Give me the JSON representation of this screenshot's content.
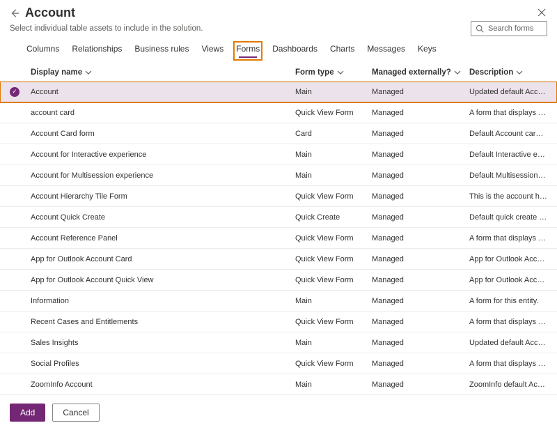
{
  "header": {
    "title": "Account",
    "subtitle": "Select individual table assets to include in the solution."
  },
  "search": {
    "placeholder": "Search forms"
  },
  "tabs": [
    {
      "label": "Columns",
      "active": false
    },
    {
      "label": "Relationships",
      "active": false
    },
    {
      "label": "Business rules",
      "active": false
    },
    {
      "label": "Views",
      "active": false
    },
    {
      "label": "Forms",
      "active": true,
      "highlighted": true
    },
    {
      "label": "Dashboards",
      "active": false
    },
    {
      "label": "Charts",
      "active": false
    },
    {
      "label": "Messages",
      "active": false
    },
    {
      "label": "Keys",
      "active": false
    }
  ],
  "columns": {
    "display_name": "Display name",
    "form_type": "Form type",
    "managed_externally": "Managed externally?",
    "description": "Description"
  },
  "rows": [
    {
      "selected": true,
      "name": "Account",
      "type": "Main",
      "ext": "Managed",
      "desc": "Updated default Account form."
    },
    {
      "selected": false,
      "name": "account card",
      "type": "Quick View Form",
      "ext": "Managed",
      "desc": "A form that displays the account card."
    },
    {
      "selected": false,
      "name": "Account Card form",
      "type": "Card",
      "ext": "Managed",
      "desc": "Default Account card form."
    },
    {
      "selected": false,
      "name": "Account for Interactive experience",
      "type": "Main",
      "ext": "Managed",
      "desc": "Default Interactive experience Account"
    },
    {
      "selected": false,
      "name": "Account for Multisession experience",
      "type": "Main",
      "ext": "Managed",
      "desc": "Default Multisession experience Account"
    },
    {
      "selected": false,
      "name": "Account Hierarchy Tile Form",
      "type": "Quick View Form",
      "ext": "Managed",
      "desc": "This is the account hierarchy definition."
    },
    {
      "selected": false,
      "name": "Account Quick Create",
      "type": "Quick Create",
      "ext": "Managed",
      "desc": "Default quick create form for Account"
    },
    {
      "selected": false,
      "name": "Account Reference Panel",
      "type": "Quick View Form",
      "ext": "Managed",
      "desc": "A form that displays Reference Panel of"
    },
    {
      "selected": false,
      "name": "App for Outlook Account Card",
      "type": "Quick View Form",
      "ext": "Managed",
      "desc": "App for Outlook Account Card"
    },
    {
      "selected": false,
      "name": "App for Outlook Account Quick View",
      "type": "Quick View Form",
      "ext": "Managed",
      "desc": "App for Outlook Account Quick View"
    },
    {
      "selected": false,
      "name": "Information",
      "type": "Main",
      "ext": "Managed",
      "desc": "A form for this entity."
    },
    {
      "selected": false,
      "name": "Recent Cases and Entitlements",
      "type": "Quick View Form",
      "ext": "Managed",
      "desc": "A form that displays the recent cases and"
    },
    {
      "selected": false,
      "name": "Sales Insights",
      "type": "Main",
      "ext": "Managed",
      "desc": "Updated default Account form."
    },
    {
      "selected": false,
      "name": "Social Profiles",
      "type": "Quick View Form",
      "ext": "Managed",
      "desc": "A form that displays social profiles of account"
    },
    {
      "selected": false,
      "name": "ZoomInfo Account",
      "type": "Main",
      "ext": "Managed",
      "desc": "ZoomInfo default Account form."
    }
  ],
  "footer": {
    "add": "Add",
    "cancel": "Cancel"
  },
  "colors": {
    "accent": "#742774",
    "highlight": "#E07B00"
  }
}
